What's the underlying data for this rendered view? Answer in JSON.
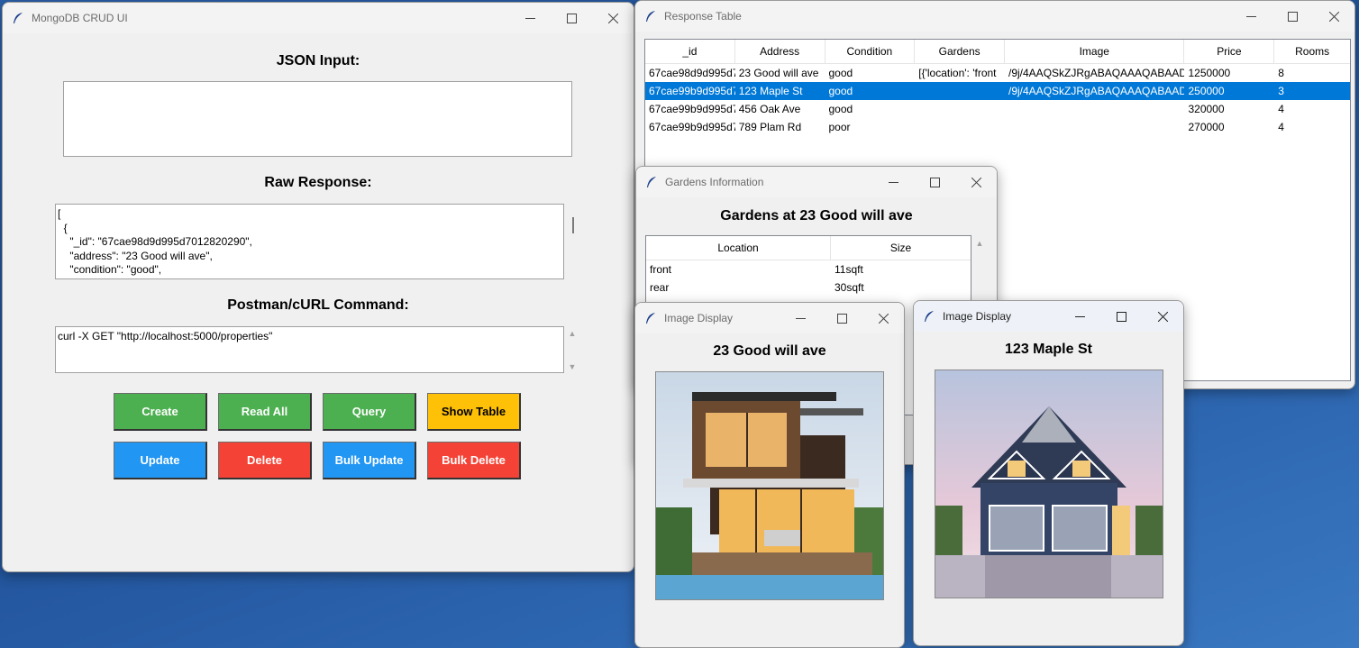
{
  "main_window": {
    "title": "MongoDB CRUD UI",
    "json_input_label": "JSON Input:",
    "json_input_value": "",
    "raw_response_label": "Raw Response:",
    "raw_response_text": "[\n  {\n    \"_id\": \"67cae98d9d995d7012820290\",\n    \"address\": \"23 Good will ave\",\n    \"condition\": \"good\",",
    "curl_label": "Postman/cURL Command:",
    "curl_text": "curl -X GET \"http://localhost:5000/properties\"",
    "buttons": {
      "create": "Create",
      "read_all": "Read All",
      "query": "Query",
      "show_table": "Show Table",
      "update": "Update",
      "delete": "Delete",
      "bulk_update": "Bulk Update",
      "bulk_delete": "Bulk Delete"
    },
    "button_colors": {
      "green": "#4caf50",
      "blue": "#2196f3",
      "red": "#f44336",
      "yellow": "#ffc107"
    }
  },
  "response_table": {
    "title": "Response Table",
    "columns": [
      "_id",
      "Address",
      "Condition",
      "Gardens",
      "Image",
      "Price",
      "Rooms"
    ],
    "rows": [
      {
        "id": "67cae98d9d995d7",
        "address": "23 Good will ave",
        "condition": "good",
        "gardens": "[{'location': 'front",
        "image": "/9j/4AAQSkZJRgABAQAAAQABAAD,",
        "price": "1250000",
        "rooms": "8",
        "selected": false
      },
      {
        "id": "67cae99b9d995d7",
        "address": "123 Maple St",
        "condition": "good",
        "gardens": "",
        "image": "/9j/4AAQSkZJRgABAQAAAQABAAD,",
        "price": "250000",
        "rooms": "3",
        "selected": true
      },
      {
        "id": "67cae99b9d995d7",
        "address": "456 Oak Ave",
        "condition": "good",
        "gardens": "",
        "image": "",
        "price": "320000",
        "rooms": "4",
        "selected": false
      },
      {
        "id": "67cae99b9d995d7",
        "address": "789 Plam Rd",
        "condition": "poor",
        "gardens": "",
        "image": "",
        "price": "270000",
        "rooms": "4",
        "selected": false
      }
    ],
    "selection_color": "#0078d7"
  },
  "gardens_window": {
    "title": "Gardens Information",
    "heading": "Gardens at 23 Good will ave",
    "columns": [
      "Location",
      "Size"
    ],
    "rows": [
      {
        "location": "front",
        "size": "11sqft"
      },
      {
        "location": "rear",
        "size": "30sqft"
      }
    ]
  },
  "image_window_1": {
    "title": "Image Display",
    "heading": "23 Good will ave"
  },
  "image_window_2": {
    "title": "Image Display",
    "heading": "123 Maple St"
  },
  "icons": [
    "feather-icon",
    "minimize-icon",
    "maximize-icon",
    "close-icon",
    "scroll-up-icon",
    "scroll-down-icon"
  ]
}
